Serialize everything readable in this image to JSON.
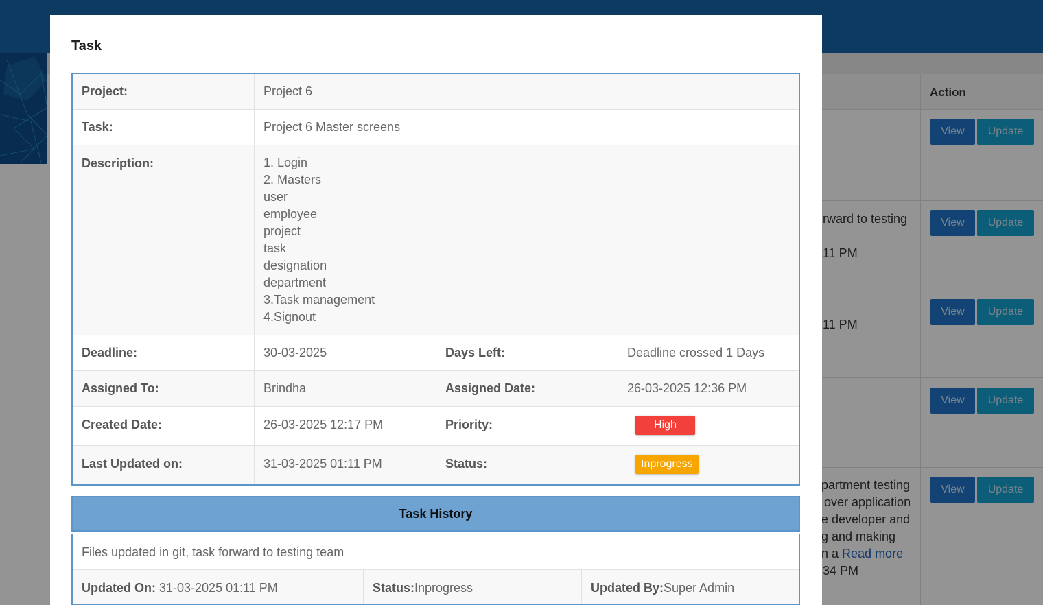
{
  "modal": {
    "title": "Task"
  },
  "details": {
    "project_label": "Project:",
    "project_value": "Project 6",
    "task_label": "Task:",
    "task_value": "Project 6 Master screens",
    "description_label": "Description:",
    "description_lines": [
      "1. Login",
      "2. Masters",
      "user",
      "employee",
      "project",
      "task",
      "designation",
      "department",
      "3.Task management",
      "4.Signout"
    ],
    "deadline_label": "Deadline:",
    "deadline_value": "30-03-2025",
    "days_left_label": "Days Left:",
    "days_left_value": "Deadline crossed 1 Days",
    "assigned_to_label": "Assigned To:",
    "assigned_to_value": "Brindha",
    "assigned_date_label": "Assigned Date:",
    "assigned_date_value": "26-03-2025 12:36 PM",
    "created_date_label": "Created Date:",
    "created_date_value": "26-03-2025 12:17 PM",
    "priority_label": "Priority:",
    "priority_value": "High",
    "last_updated_label": "Last Updated on:",
    "last_updated_value": "31-03-2025 01:11 PM",
    "status_label": "Status:",
    "status_value": "Inprogress"
  },
  "history": {
    "title": "Task History",
    "message": "Files updated in git, task forward to testing team",
    "updated_on_label": "Updated On:",
    "updated_on_value": " 31-03-2025 01:11 PM",
    "status_label": "Status:",
    "status_value": "Inprogress",
    "updated_by_label": "Updated By:",
    "updated_by_value": "Super Admin"
  },
  "background": {
    "action_header": "Action",
    "view_label": "View",
    "update_label": "Update",
    "row2_text": "rward to testing",
    "row2_time": "11 PM",
    "row3_time": "11 PM",
    "row5_lines": [
      "partment testing",
      "over application",
      "e developer and",
      "g and making"
    ],
    "row5_prefix": "n a ",
    "row5_link": "Read more",
    "row5_time": "34 PM"
  },
  "colors": {
    "header": "#1565a6",
    "accent_border": "#5b95c9",
    "history_head": "#6ea2d0",
    "high": "#f2403a",
    "inprogress": "#f7a600"
  }
}
